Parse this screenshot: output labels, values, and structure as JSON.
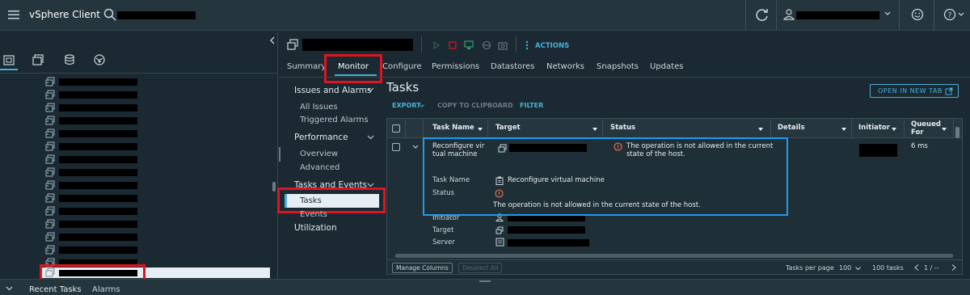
{
  "app": {
    "title": "vSphere Client"
  },
  "toolbar": {
    "actions_label": "ACTIONS"
  },
  "tabs": [
    "Summary",
    "Monitor",
    "Configure",
    "Permissions",
    "Datastores",
    "Networks",
    "Snapshots",
    "Updates"
  ],
  "subnav": {
    "issues_section": "Issues and Alarms",
    "all_issues": "All Issues",
    "triggered_alarms": "Triggered Alarms",
    "performance_section": "Performance",
    "overview": "Overview",
    "advanced": "Advanced",
    "tasks_events_section": "Tasks and Events",
    "tasks": "Tasks",
    "events": "Events",
    "utilization": "Utilization"
  },
  "main": {
    "title": "Tasks",
    "open_new_tab": "OPEN IN NEW TAB",
    "export": "EXPORT",
    "copy_clipboard": "COPY TO CLIPBOARD",
    "filter": "FILTER"
  },
  "grid": {
    "columns": [
      "Task Name",
      "Target",
      "Status",
      "Details",
      "Initiator",
      "Queued\nFor"
    ],
    "row": {
      "task_name": "Reconfigure vir\ntual machine",
      "status": "The operation is not allowed in the current\nstate of the host.",
      "queued_for": "6 ms"
    },
    "detail": {
      "task_name_label": "Task Name",
      "task_name_value": "Reconfigure virtual machine",
      "status_label": "Status",
      "status_message": "The operation is not allowed in the current state of the host.",
      "initiator_label": "Initiator",
      "target_label": "Target",
      "server_label": "Server"
    },
    "footer": {
      "manage_columns": "Manage Columns",
      "deselect_all": "Deselect All",
      "tasks_per_page_label": "Tasks per page",
      "tasks_per_page_value": "100",
      "task_count": "100 tasks",
      "page_indicator": "1 / --"
    }
  },
  "bottom": {
    "recent_tasks": "Recent Tasks",
    "alarms": "Alarms"
  },
  "colors": {
    "accent": "#49afd9",
    "alert": "#e0141e",
    "highlight": "#1e9bf0"
  }
}
